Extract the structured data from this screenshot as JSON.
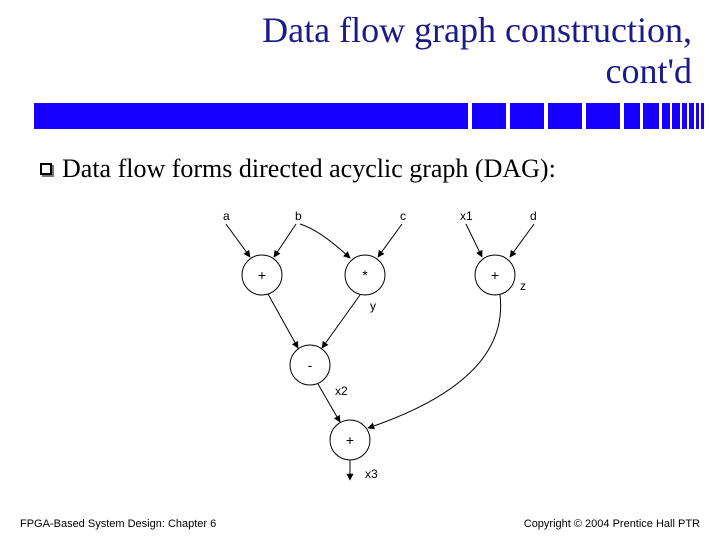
{
  "title": {
    "line1": "Data flow graph construction,",
    "line2": "cont'd"
  },
  "body": {
    "bullet_text": "Data flow forms directed acyclic graph (DAG):"
  },
  "diagram": {
    "inputs": [
      "a",
      "b",
      "c",
      "x1",
      "d"
    ],
    "nodes": [
      {
        "id": "n1",
        "op": "+",
        "inputs": [
          "a",
          "b"
        ]
      },
      {
        "id": "n2",
        "op": "*",
        "inputs": [
          "b",
          "c"
        ],
        "out": "y"
      },
      {
        "id": "n3",
        "op": "+",
        "inputs": [
          "x1",
          "d"
        ],
        "out": "z"
      },
      {
        "id": "n4",
        "op": "-",
        "inputs": [
          "n1",
          "n2"
        ],
        "out": "x2"
      },
      {
        "id": "n5",
        "op": "+",
        "inputs": [
          "n4",
          "n3"
        ],
        "out": "x3"
      }
    ],
    "labels": {
      "y": "y",
      "z": "z",
      "x2": "x2",
      "x3": "x3"
    }
  },
  "footer": {
    "left": "FPGA-Based System Design: Chapter 6",
    "right": "Copyright © 2004 Prentice Hall PTR"
  }
}
